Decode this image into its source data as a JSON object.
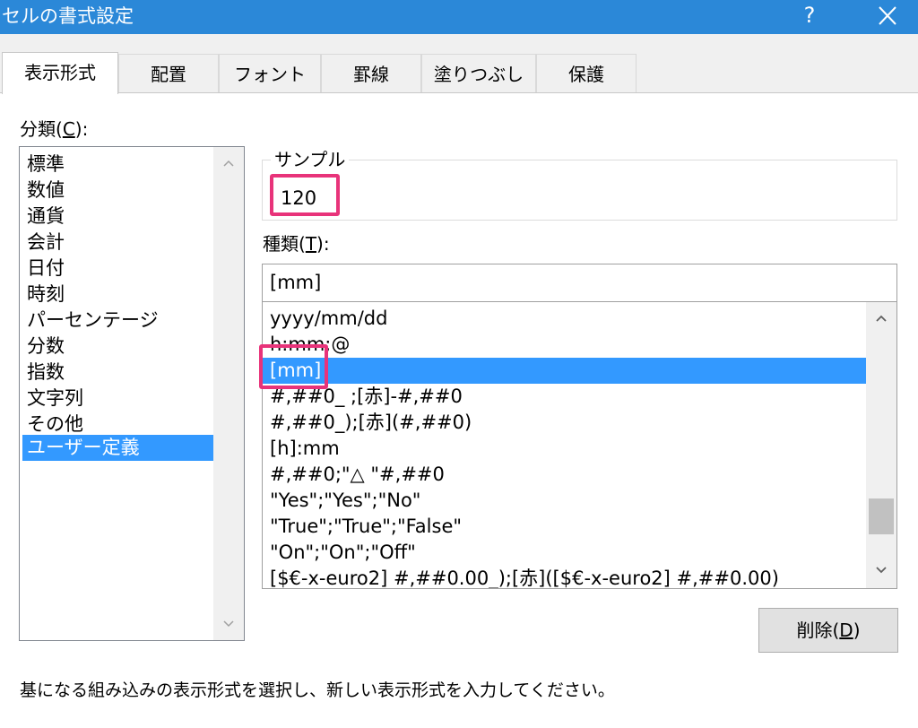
{
  "window": {
    "title": "セルの書式設定",
    "help_label": "?"
  },
  "tabs": [
    {
      "label": "表示形式",
      "active": true
    },
    {
      "label": "配置",
      "active": false
    },
    {
      "label": "フォント",
      "active": false
    },
    {
      "label": "罫線",
      "active": false
    },
    {
      "label": "塗りつぶし",
      "active": false
    },
    {
      "label": "保護",
      "active": false
    }
  ],
  "category": {
    "label_text": "分類(",
    "label_key": "C",
    "label_tail": "):",
    "items": [
      "標準",
      "数値",
      "通貨",
      "会計",
      "日付",
      "時刻",
      "パーセンテージ",
      "分数",
      "指数",
      "文字列",
      "その他",
      "ユーザー定義"
    ],
    "selected": "ユーザー定義"
  },
  "sample": {
    "legend": "サンプル",
    "value": "120"
  },
  "type": {
    "label_text": "種類(",
    "label_key": "T",
    "label_tail": "):",
    "value": "[mm]",
    "list": [
      "yyyy/mm/dd",
      "h:mm;@",
      "[mm]",
      "#,##0_ ;[赤]-#,##0",
      "#,##0_);[赤](#,##0)",
      "[h]:mm",
      "#,##0;\"△ \"#,##0",
      "\"Yes\";\"Yes\";\"No\"",
      "\"True\";\"True\";\"False\"",
      "\"On\";\"On\";\"Off\"",
      "[$€-x-euro2] #,##0.00_);[赤]([$€-x-euro2] #,##0.00)"
    ],
    "selected": "[mm]",
    "scroll_position": 0.86
  },
  "delete_button": {
    "label_text": "削除(",
    "label_key": "D",
    "label_tail": ")"
  },
  "description": "基になる組み込みの表示形式を選択し、新しい表示形式を入力してください。",
  "colors": {
    "titlebar": "#2b88d8",
    "selection": "#3399ff",
    "annotation": "#e8337a"
  }
}
